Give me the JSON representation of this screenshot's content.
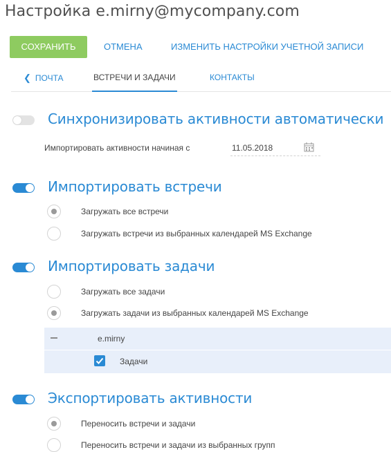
{
  "page": {
    "title": "Настройка e.mirny@mycompany.com"
  },
  "toolbar": {
    "save_label": "СОХРАНИТЬ",
    "cancel_label": "ОТМЕНА",
    "account_settings_label": "ИЗМЕНИТЬ НАСТРОЙКИ УЧЕТНОЙ ЗАПИСИ"
  },
  "tabs": [
    {
      "label": "ПОЧТА",
      "active": false
    },
    {
      "label": "ВСТРЕЧИ И ЗАДАЧИ",
      "active": true
    },
    {
      "label": "КОНТАКТЫ",
      "active": false
    }
  ],
  "sync": {
    "label": "Синхронизировать активности автоматически",
    "enabled": false,
    "import_from_label": "Импортировать активности начиная с",
    "import_from_date": "11.05.2018"
  },
  "meetings": {
    "label": "Импортировать встречи",
    "enabled": true,
    "options": [
      {
        "label": "Загружать все встречи",
        "selected": true
      },
      {
        "label": "Загружать встречи из выбранных календарей MS Exchange",
        "selected": false
      }
    ]
  },
  "tasks": {
    "label": "Импортировать задачи",
    "enabled": true,
    "options": [
      {
        "label": "Загружать все задачи",
        "selected": false
      },
      {
        "label": "Загружать задачи из выбранных календарей MS Exchange",
        "selected": true
      }
    ],
    "calendar_group": {
      "name": "e.mirny",
      "items": [
        {
          "label": "Задачи",
          "checked": true
        }
      ]
    }
  },
  "export": {
    "label": "Экспортировать активности",
    "enabled": true,
    "options": [
      {
        "label": "Переносить встречи и задачи",
        "selected": true
      },
      {
        "label": "Переносить встречи и задачи из выбранных групп",
        "selected": false
      }
    ]
  },
  "colors": {
    "accent": "#2a8ad4",
    "save_button": "#8ecb60",
    "group_background": "#e8effa"
  },
  "icons": {
    "calendar": "calendar-icon",
    "back": "chevron-left-icon",
    "collapse": "minus-icon",
    "check": "checkmark-icon"
  }
}
